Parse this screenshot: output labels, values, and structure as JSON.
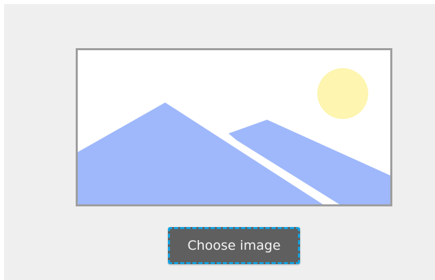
{
  "upload": {
    "choose_label": "Choose image"
  },
  "icons": {
    "placeholder": "landscape-image-placeholder-icon"
  },
  "colors": {
    "background": "#efefef",
    "frame_border": "#9e9e9e",
    "mountain": "#9fb8fb",
    "sun": "#fdf5b0",
    "button_bg": "#5f5f5f",
    "button_focus_outline": "#14a3e2",
    "button_text": "#f4f4f4"
  }
}
